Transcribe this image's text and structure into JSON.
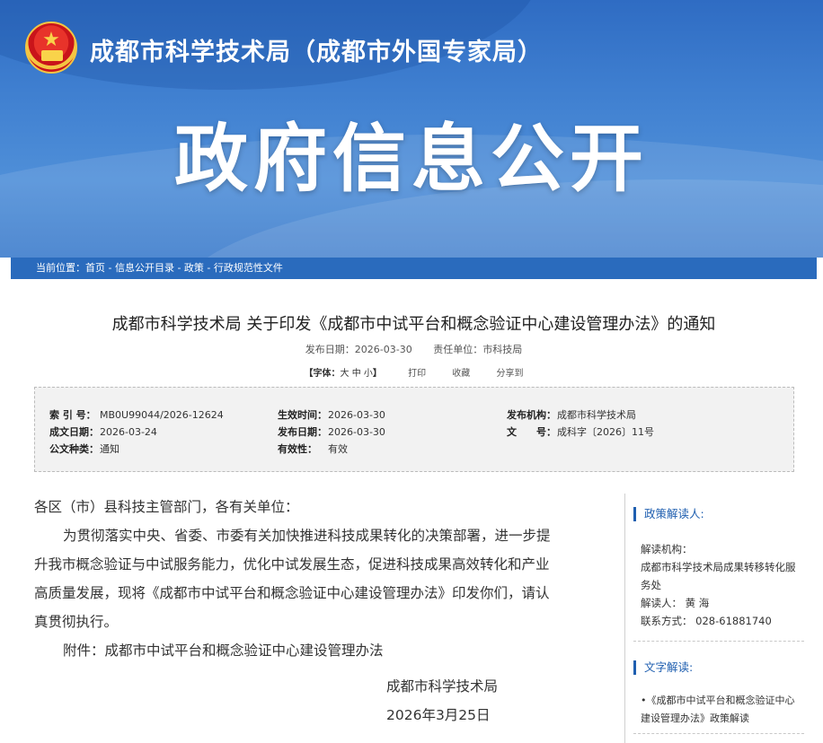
{
  "header": {
    "site_title": "成都市科学技术局（成都市外国专家局）",
    "banner_title": "政府信息公开",
    "emblem_icon": "national-emblem-icon"
  },
  "breadcrumb": {
    "text": "当前位置：首页 - 信息公开目录 - 政策 - 行政规范性文件"
  },
  "document": {
    "title": "成都市科学技术局 关于印发《成都市中试平台和概念验证中心建设管理办法》的通知",
    "publish_date_label": "发布日期：2026-03-30",
    "unit_label": "责任单位：市科技局",
    "font_size_label_prefix": "【字体：",
    "font_size_options": "大 中 小",
    "font_size_label_suffix": "】",
    "print_label": "打印",
    "favorite_label": "收藏",
    "share_label": "分享到"
  },
  "info": {
    "index_key": "索 引 号：",
    "index_val": "MB0U99044/2026-12624",
    "effective_time_key": "生效时间：",
    "effective_time_val": "2026-03-30",
    "issuer_key": "发布机构：",
    "issuer_val": "成都市科学技术局",
    "written_date_key": "成文日期：",
    "written_date_val": "2026-03-24",
    "publish_date_key": "发布日期：",
    "publish_date_val": "2026-03-30",
    "doc_no_key": "文　　号：",
    "doc_no_val": "成科字〔2026〕11号",
    "doc_type_key": "公文种类：",
    "doc_type_val": "通知",
    "validity_key": "有效性：",
    "validity_val": "有效"
  },
  "body": {
    "salutation": "各区（市）县科技主管部门，各有关单位：",
    "para1_line1": "为贯彻落实中央、省委、市委有关加快推进科技成果转化的决策部署，进一步提",
    "para1_line2": "升我市概念验证与中试服务能力，优化中试发展生态，促进科技成果高效转化和产业",
    "para1_line3": "高质量发展，现将《成都市中试平台和概念验证中心建设管理办法》印发你们，请认",
    "para1_line4": "真贯彻执行。",
    "attachment": "附件：成都市中试平台和概念验证中心建设管理办法",
    "sign_org": "成都市科学技术局",
    "sign_date": "2026年3月25日"
  },
  "sidebar": {
    "interpreter_heading": "政策解读人:",
    "org_label": "解读机构：",
    "org_value": "成都市科学技术局成果转移转化服务处",
    "person_label": "解读人：",
    "person_value": "黄 海",
    "contact_label": "联系方式：",
    "contact_value": "028-61881740",
    "text_heading": "文字解读:",
    "text_link": "•《成都市中试平台和概念验证中心建设管理办法》政策解读"
  }
}
